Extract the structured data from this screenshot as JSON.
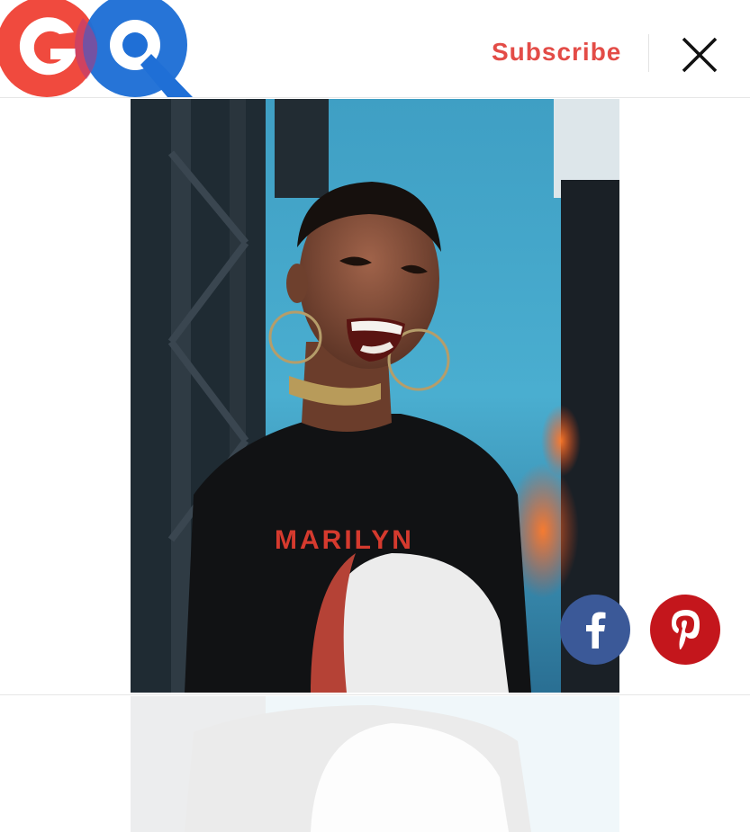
{
  "header": {
    "logo_text": "GQ",
    "subscribe_label": "Subscribe",
    "close_icon": "close-icon"
  },
  "photo": {
    "shirt_text": "MARILYN"
  },
  "share": {
    "facebook_icon": "facebook-icon",
    "pinterest_icon": "pinterest-icon"
  },
  "colors": {
    "brand_red": "#e34c47",
    "logo_red": "#f04a3e",
    "logo_blue": "#1f6fd6",
    "facebook_blue": "#3b5998",
    "pinterest_red": "#c4161c"
  }
}
